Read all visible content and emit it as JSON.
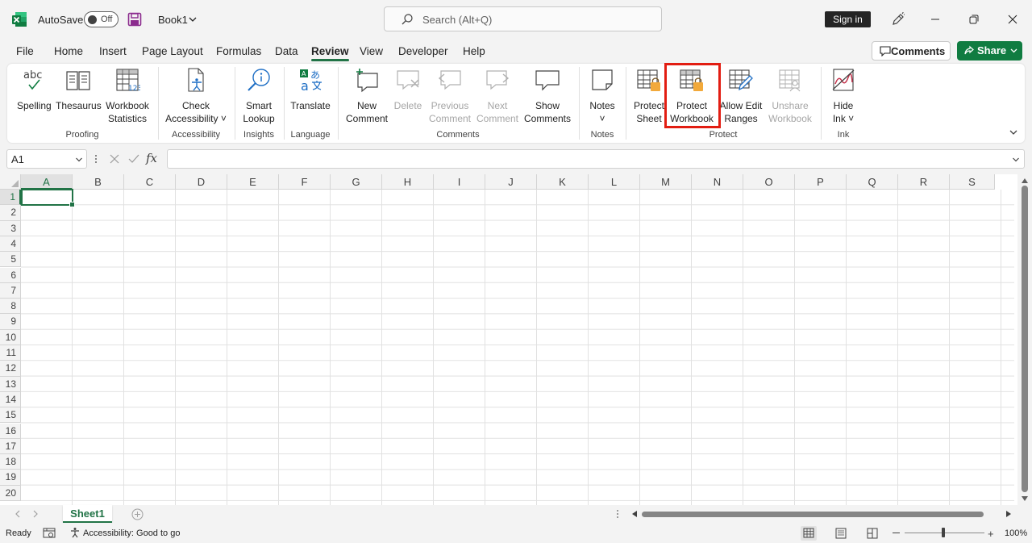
{
  "titlebar": {
    "autosave_label": "AutoSave",
    "autosave_state": "Off",
    "book_title": "Book1",
    "search_placeholder": "Search (Alt+Q)",
    "signin_label": "Sign in"
  },
  "menu": {
    "tabs": [
      "File",
      "Home",
      "Insert",
      "Page Layout",
      "Formulas",
      "Data",
      "Review",
      "View",
      "Developer",
      "Help"
    ],
    "active_tab": "Review",
    "comments_label": "Comments",
    "share_label": "Share"
  },
  "ribbon": {
    "groups": {
      "proofing": "Proofing",
      "accessibility": "Accessibility",
      "insights": "Insights",
      "language": "Language",
      "comments": "Comments",
      "notes": "Notes",
      "protect": "Protect",
      "ink": "Ink"
    },
    "buttons": {
      "spelling": "Spelling",
      "thesaurus": "Thesaurus",
      "workbook_statistics_1": "Workbook",
      "workbook_statistics_2": "Statistics",
      "check_accessibility_1": "Check",
      "check_accessibility_2": "Accessibility ˅",
      "smart_lookup_1": "Smart",
      "smart_lookup_2": "Lookup",
      "translate": "Translate",
      "new_comment_1": "New",
      "new_comment_2": "Comment",
      "delete": "Delete",
      "previous_comment_1": "Previous",
      "previous_comment_2": "Comment",
      "next_comment_1": "Next",
      "next_comment_2": "Comment",
      "show_comments_1": "Show",
      "show_comments_2": "Comments",
      "notes_1": "Notes",
      "notes_2": "˅",
      "protect_sheet_1": "Protect",
      "protect_sheet_2": "Sheet",
      "protect_workbook_1": "Protect",
      "protect_workbook_2": "Workbook",
      "allow_edit_ranges_1": "Allow Edit",
      "allow_edit_ranges_2": "Ranges",
      "unshare_workbook_1": "Unshare",
      "unshare_workbook_2": "Workbook",
      "hide_ink_1": "Hide",
      "hide_ink_2": "Ink ˅"
    }
  },
  "formula_bar": {
    "name_box": "A1",
    "fx": "fx",
    "value": ""
  },
  "grid": {
    "columns": [
      "A",
      "B",
      "C",
      "D",
      "E",
      "F",
      "G",
      "H",
      "I",
      "J",
      "K",
      "L",
      "M",
      "N",
      "O",
      "P",
      "Q",
      "R",
      "S"
    ],
    "rows": [
      "1",
      "2",
      "3",
      "4",
      "5",
      "6",
      "7",
      "8",
      "9",
      "10",
      "11",
      "12",
      "13",
      "14",
      "15",
      "16",
      "17",
      "18",
      "19",
      "20"
    ],
    "active_cell": "A1"
  },
  "sheets": {
    "tabs": [
      "Sheet1"
    ],
    "active": "Sheet1"
  },
  "status": {
    "ready": "Ready",
    "accessibility": "Accessibility: Good to go",
    "zoom": "100%"
  },
  "colors": {
    "excel_green": "#217346",
    "share_green": "#107c41",
    "highlight_red": "#e21d12"
  }
}
